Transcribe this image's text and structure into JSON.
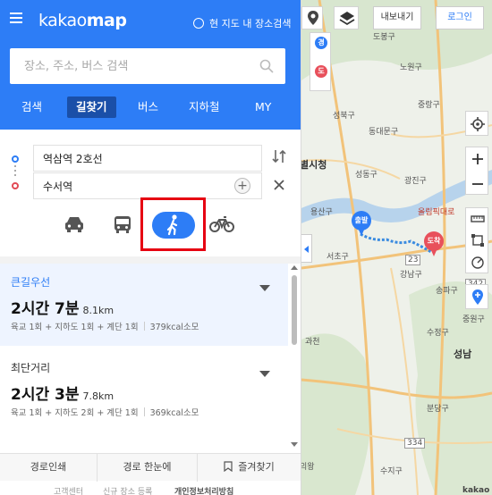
{
  "header": {
    "logo_light": "kakao",
    "logo_bold": "map",
    "map_search_toggle": "현 지도 내 장소검색",
    "search_placeholder": "장소, 주소, 버스 검색",
    "tabs": [
      "검색",
      "길찾기",
      "버스",
      "지하철",
      "MY"
    ],
    "active_tab": "길찾기",
    "brand_color": "#2d7df6"
  },
  "route": {
    "start": "역삼역 2호선",
    "end": "수서역",
    "add_stop": "+",
    "modes": [
      {
        "name": "car",
        "icon": "car-icon"
      },
      {
        "name": "transit",
        "icon": "bus-icon"
      },
      {
        "name": "walk",
        "icon": "walk-icon",
        "selected": true
      },
      {
        "name": "bike",
        "icon": "bike-icon"
      }
    ]
  },
  "results": [
    {
      "title": "큰길우선",
      "time": "2시간 7분",
      "distance": "8.1km",
      "detail": "육교 1회 + 지하도 1회 + 계단 1회",
      "calories": "379kcal소모"
    },
    {
      "title": "최단거리",
      "time": "2시간 3분",
      "distance": "7.8km",
      "detail": "육교 1회 + 지하도 2회 + 계단 1회",
      "calories": "369kcal소모"
    }
  ],
  "bottom_bar": {
    "print": "경로인쇄",
    "overview": "경로 한눈에",
    "favorite": "즐겨찾기"
  },
  "footer": [
    "고객센터",
    "신규 장소 등록",
    "개인정보처리방침"
  ],
  "map": {
    "top_buttons": {
      "export": "내보내기",
      "login": "로그인"
    },
    "pins": {
      "start": "출발",
      "end": "도착",
      "via1": "경",
      "via2": "도"
    },
    "labels": [
      "도봉구",
      "노원구",
      "성북구",
      "동대문구",
      "중랑구",
      "별시청",
      "성동구",
      "광진구",
      "용산구",
      "올림픽대로",
      "강남구",
      "송파구",
      "서초구",
      "과천",
      "성남",
      "수정구",
      "분당구",
      "중원구",
      "의왕",
      "수지구",
      "23",
      "342",
      "334",
      "kakao"
    ]
  }
}
